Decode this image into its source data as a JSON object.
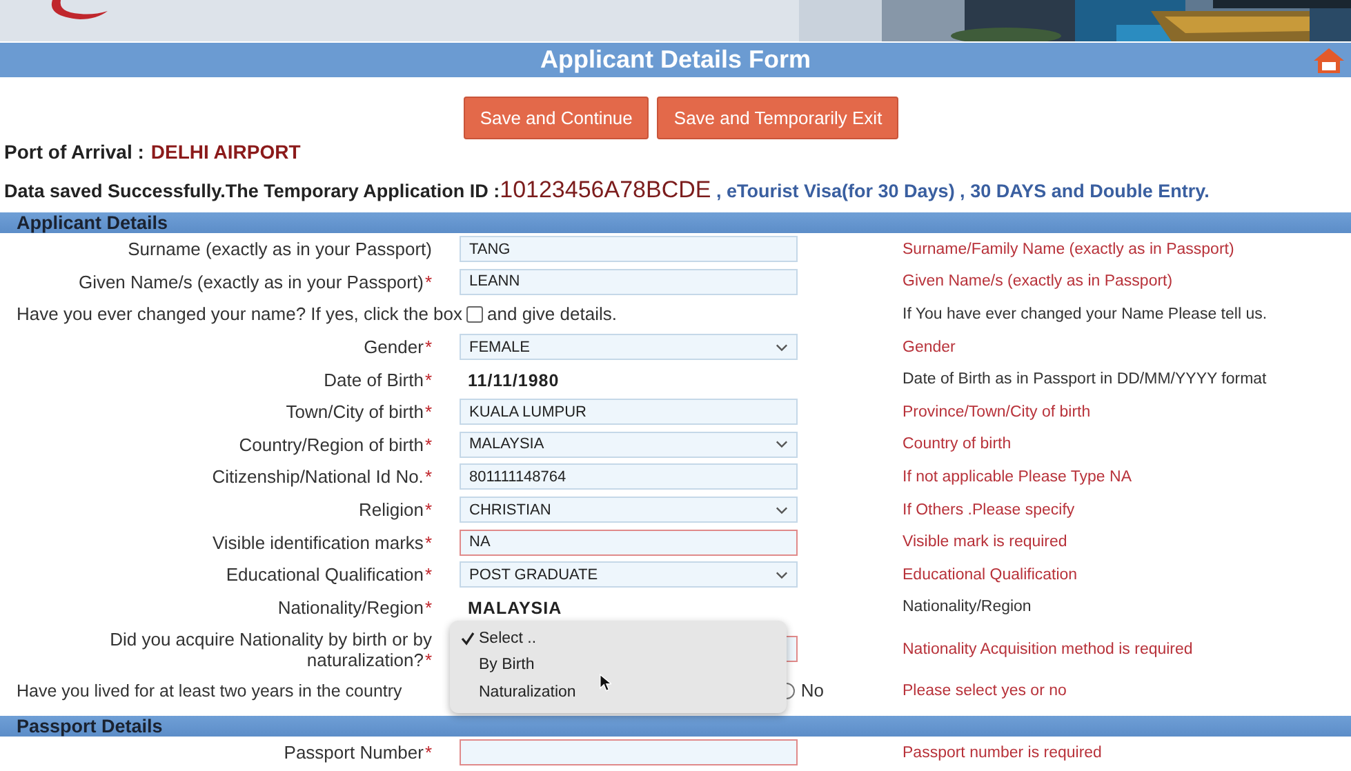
{
  "form_title": "Applicant Details Form",
  "buttons": [
    "Save and Continue",
    "Save and Temporarily Exit"
  ],
  "port_of_arrival": {
    "label": "Port of Arrival :",
    "value": "DELHI AIRPORT"
  },
  "status_message": {
    "text": "Data saved Successfully.The Temporary Application ID :",
    "application_id": "10123456A78BCDE",
    "visa_info": ", eTourist Visa(for 30 Days) , 30 DAYS and Double Entry."
  },
  "sections": [
    {
      "title": "Applicant Details",
      "rows": [
        {
          "kind": "text",
          "label": "Surname (exactly as in your Passport)",
          "value": "TANG",
          "invalid": false,
          "hint": {
            "text": "Surname/Family Name (exactly as in Passport)",
            "kind": "error"
          }
        },
        {
          "kind": "text",
          "label": "Given Name/s (exactly as in your Passport)",
          "mark": "*",
          "value": "LEANN",
          "invalid": false,
          "hint": {
            "text": "Given Name/s (exactly as in Passport)",
            "kind": "error"
          }
        },
        {
          "kind": "check",
          "before": "Have you ever changed your name? If yes, click the box",
          "after": "and give details.",
          "checked": false,
          "hint": {
            "text": "If You have ever changed your Name Please tell us.",
            "kind": "info"
          }
        },
        {
          "kind": "select",
          "label": "Gender",
          "mark": "*",
          "value": "FEMALE",
          "hint": {
            "text": "Gender",
            "kind": "error"
          }
        },
        {
          "kind": "static",
          "label": "Date of Birth",
          "mark": "*",
          "value": "11/11/1980",
          "hint": {
            "text": "Date of Birth as in Passport in DD/MM/YYYY format",
            "kind": "info"
          }
        },
        {
          "kind": "text",
          "label": "Town/City of birth",
          "mark": "*",
          "value": "KUALA LUMPUR",
          "invalid": false,
          "hint": {
            "text": "Province/Town/City of birth",
            "kind": "error"
          }
        },
        {
          "kind": "select",
          "label": "Country/Region of birth",
          "mark": "*",
          "value": "MALAYSIA",
          "hint": {
            "text": "Country of birth",
            "kind": "error"
          }
        },
        {
          "kind": "text",
          "label": "Citizenship/National Id No.",
          "mark": "*",
          "value": "801111148764",
          "invalid": false,
          "hint": {
            "text": "If not applicable Please Type NA",
            "kind": "error"
          }
        },
        {
          "kind": "select",
          "label": "Religion",
          "mark": "*",
          "value": "CHRISTIAN",
          "hint": {
            "text": "If Others .Please specify",
            "kind": "error"
          }
        },
        {
          "kind": "text",
          "label": "Visible identification marks",
          "mark": "*",
          "value": "NA",
          "invalid": true,
          "hint": {
            "text": "Visible mark is required",
            "kind": "error"
          }
        },
        {
          "kind": "select",
          "label": "Educational Qualification",
          "mark": "*",
          "value": "POST GRADUATE",
          "hint": {
            "text": "Educational Qualification",
            "kind": "error"
          }
        },
        {
          "kind": "static",
          "label": "Nationality/Region",
          "mark": "*",
          "value": "MALAYSIA",
          "hint": {
            "text": "Nationality/Region",
            "kind": "info"
          }
        },
        {
          "kind": "open_select",
          "label": "Did you acquire Nationality by birth or by naturalization?",
          "mark": "*",
          "options": [
            {
              "label": "Select ..",
              "selected": true
            },
            {
              "label": "By Birth",
              "selected": false
            },
            {
              "label": "Naturalization",
              "selected": false
            }
          ],
          "hint": {
            "text": "Nationality Acquisition method is required",
            "kind": "error"
          }
        },
        {
          "kind": "radio",
          "label": "Have you lived for at least two years in the country",
          "option": "No",
          "selected": false,
          "hint": {
            "text": "Please select yes or no",
            "kind": "error"
          }
        }
      ]
    },
    {
      "title": "Passport Details",
      "rows": [
        {
          "kind": "text",
          "label": "Passport Number",
          "mark": "*",
          "value": "",
          "invalid": true,
          "hint": {
            "text": "Passport number is required",
            "kind": "error"
          }
        }
      ]
    }
  ]
}
